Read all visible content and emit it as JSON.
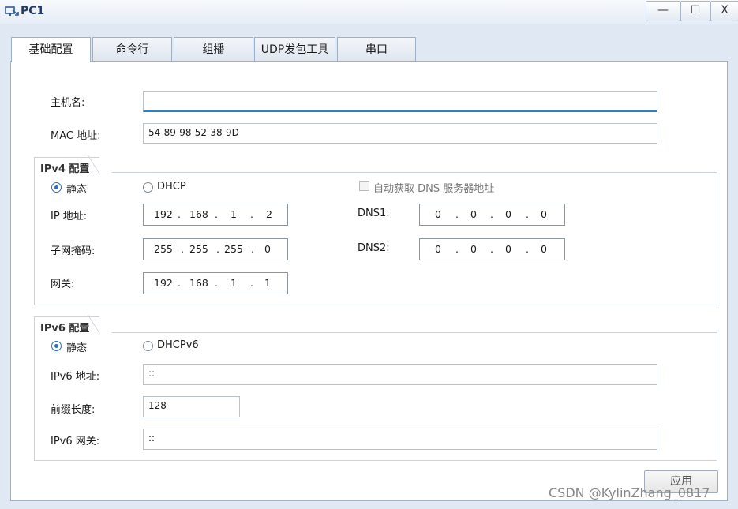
{
  "window": {
    "title": "PC1",
    "controls": {
      "minimize": "—",
      "maximize": "☐",
      "close": "X"
    }
  },
  "tabs": [
    "基础配置",
    "命令行",
    "组播",
    "UDP发包工具",
    "串口"
  ],
  "basic": {
    "hostname_label": "主机名:",
    "hostname_value": "",
    "mac_label": "MAC 地址:",
    "mac_value": "54-89-98-52-38-9D"
  },
  "ipv4": {
    "group_label": "IPv4 配置",
    "static_label": "静态",
    "dhcp_label": "DHCP",
    "auto_dns_label": "自动获取 DNS 服务器地址",
    "ip_label": "IP 地址:",
    "ip": [
      "192",
      "168",
      "1",
      "2"
    ],
    "mask_label": "子网掩码:",
    "mask": [
      "255",
      "255",
      "255",
      "0"
    ],
    "gateway_label": "网关:",
    "gateway": [
      "192",
      "168",
      "1",
      "1"
    ],
    "dns1_label": "DNS1:",
    "dns1": [
      "0",
      "0",
      "0",
      "0"
    ],
    "dns2_label": "DNS2:",
    "dns2": [
      "0",
      "0",
      "0",
      "0"
    ]
  },
  "ipv6": {
    "group_label": "IPv6 配置",
    "static_label": "静态",
    "dhcp_label": "DHCPv6",
    "addr_label": "IPv6 地址:",
    "addr_value": "::",
    "prefix_label": "前缀长度:",
    "prefix_value": "128",
    "gateway_label": "IPv6 网关:",
    "gateway_value": "::"
  },
  "apply_label": "应用",
  "watermark": "CSDN @KylinZhang_0817"
}
